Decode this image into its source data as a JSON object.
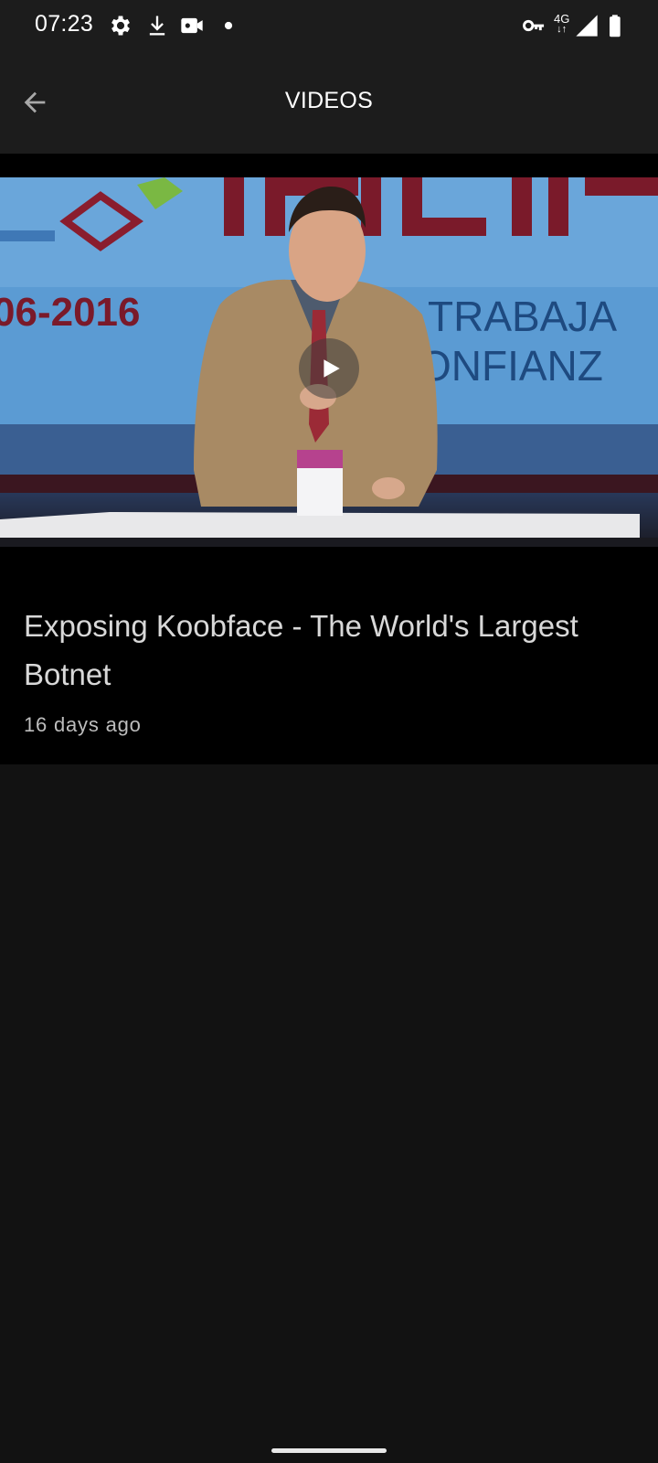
{
  "status_bar": {
    "time": "07:23",
    "network": "4G",
    "icons": [
      "settings-icon",
      "download-icon",
      "video-camera-icon",
      "dot-icon",
      "vpn-key-icon",
      "signal-icon",
      "battery-icon"
    ]
  },
  "app_bar": {
    "title": "VIDEOS",
    "back_icon": "arrow-back-icon"
  },
  "video": {
    "title": "Exposing Koobface - The World's Largest Botnet",
    "posted": "16 days ago",
    "thumbnail_banner_left": "06-2016",
    "thumbnail_banner_right_1": "TRABAJA",
    "thumbnail_banner_right_2": "ONFIANZ",
    "thumbnail_banner_top": "INCIB",
    "play_icon": "play-icon"
  },
  "colors": {
    "background": "#121212",
    "app_bar": "#1c1c1c",
    "card": "#000000",
    "title_text": "#d8d8d8",
    "meta_text": "#bdbdbd"
  }
}
